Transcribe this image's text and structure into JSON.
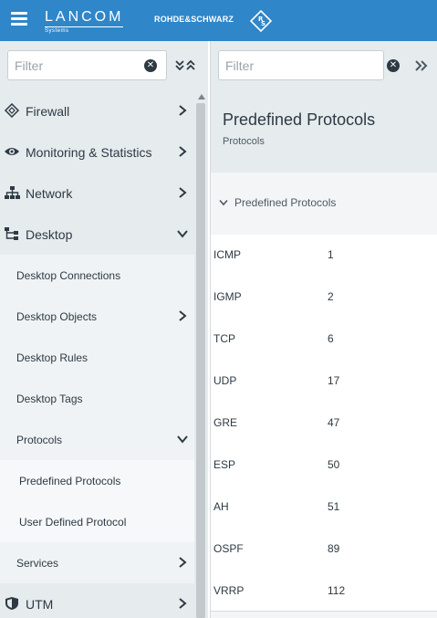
{
  "header": {
    "brand_name": "LANCOM",
    "brand_sub": "Systems",
    "partner_name": "ROHDE&SCHWARZ",
    "partner_logo_text": "RS",
    "accent_color": "#2f86c9"
  },
  "left_panel": {
    "filter_placeholder": "Filter",
    "nav_items": [
      {
        "label": "Firewall",
        "icon": "firewall-icon",
        "level": 0,
        "state": "collapsed"
      },
      {
        "label": "Monitoring & Statistics",
        "icon": "eye-icon",
        "level": 0,
        "state": "collapsed"
      },
      {
        "label": "Network",
        "icon": "network-icon",
        "level": 0,
        "state": "collapsed"
      },
      {
        "label": "Desktop",
        "icon": "desktop-icon",
        "level": 0,
        "state": "expanded"
      },
      {
        "label": "Desktop Connections",
        "level": 1
      },
      {
        "label": "Desktop Objects",
        "level": 1,
        "state": "collapsed"
      },
      {
        "label": "Desktop Rules",
        "level": 1
      },
      {
        "label": "Desktop Tags",
        "level": 1
      },
      {
        "label": "Protocols",
        "level": 1,
        "state": "expanded"
      },
      {
        "label": "Predefined Protocols",
        "level": 2
      },
      {
        "label": "User Defined Protocol",
        "level": 2
      },
      {
        "label": "Services",
        "level": 1,
        "state": "collapsed"
      },
      {
        "label": "UTM",
        "icon": "shield-icon",
        "level": 0,
        "state": "collapsed"
      }
    ]
  },
  "right_panel": {
    "filter_placeholder": "Filter",
    "page_title": "Predefined Protocols",
    "breadcrumb": "Protocols",
    "section_label": "Predefined Protocols",
    "protocols": [
      {
        "name": "ICMP",
        "number": "1"
      },
      {
        "name": "IGMP",
        "number": "2"
      },
      {
        "name": "TCP",
        "number": "6"
      },
      {
        "name": "UDP",
        "number": "17"
      },
      {
        "name": "GRE",
        "number": "47"
      },
      {
        "name": "ESP",
        "number": "50"
      },
      {
        "name": "AH",
        "number": "51"
      },
      {
        "name": "OSPF",
        "number": "89"
      },
      {
        "name": "VRRP",
        "number": "112"
      }
    ]
  }
}
